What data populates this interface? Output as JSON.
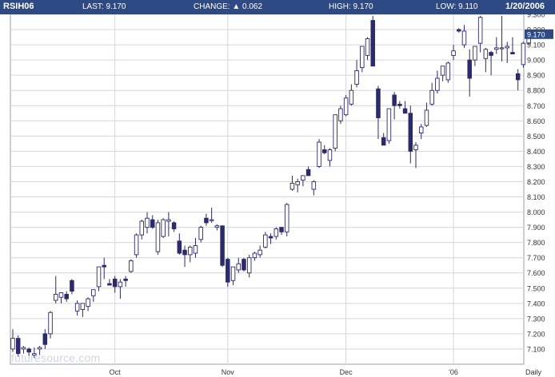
{
  "header": {
    "symbol": "RSIH06",
    "last": "LAST: 9.170",
    "change": "CHANGE: ▲ 0.062",
    "high": "HIGH: 9.170",
    "low": "LOW: 9.110",
    "date": "1/20/2006"
  },
  "watermark": "futuresource.com",
  "colors": {
    "header_bg": "#2e4a84",
    "up_candle": "#ffffff",
    "down_candle": "#2b2a6b",
    "grid": "#d3d6de",
    "last_badge": "#2e4a84"
  },
  "chart_data": {
    "type": "candlestick",
    "ylim": [
      7.0,
      9.3
    ],
    "yticks": [
      "7.100",
      "7.200",
      "7.300",
      "7.400",
      "7.500",
      "7.600",
      "7.700",
      "7.800",
      "7.900",
      "8.000",
      "8.100",
      "8.200",
      "8.300",
      "8.400",
      "8.500",
      "8.600",
      "8.700",
      "8.800",
      "8.900",
      "9.000",
      "9.100",
      "9.200",
      "9.300"
    ],
    "last_label": "9.170",
    "xlabels": [
      {
        "label": "Oct",
        "index": 19
      },
      {
        "label": "Nov",
        "index": 40
      },
      {
        "label": "Dec",
        "index": 62
      },
      {
        "label": "'06",
        "index": 82
      },
      {
        "label": "Daily",
        "index": 97
      }
    ],
    "candles": [
      [
        7.1,
        7.23,
        7.08,
        7.17
      ],
      [
        7.17,
        7.19,
        7.05,
        7.07
      ],
      [
        7.1,
        7.12,
        7.07,
        7.11
      ],
      [
        7.1,
        7.11,
        7.05,
        7.08
      ],
      [
        7.06,
        7.11,
        7.04,
        7.07
      ],
      [
        7.1,
        7.12,
        7.06,
        7.11
      ],
      [
        7.2,
        7.23,
        7.1,
        7.13
      ],
      [
        7.2,
        7.35,
        7.17,
        7.34
      ],
      [
        7.42,
        7.58,
        7.4,
        7.46
      ],
      [
        7.44,
        7.47,
        7.4,
        7.47
      ],
      [
        7.46,
        7.48,
        7.41,
        7.43
      ],
      [
        7.55,
        7.56,
        7.46,
        7.48
      ],
      [
        7.35,
        7.42,
        7.32,
        7.4
      ],
      [
        7.36,
        7.4,
        7.31,
        7.4
      ],
      [
        7.38,
        7.44,
        7.35,
        7.43
      ],
      [
        7.45,
        7.49,
        7.41,
        7.49
      ],
      [
        7.51,
        7.64,
        7.48,
        7.64
      ],
      [
        7.65,
        7.7,
        7.56,
        7.64
      ],
      [
        7.53,
        7.56,
        7.52,
        7.52
      ],
      [
        7.56,
        7.58,
        7.47,
        7.51
      ],
      [
        7.51,
        7.56,
        7.43,
        7.54
      ],
      [
        7.56,
        7.58,
        7.51,
        7.55
      ],
      [
        7.61,
        7.69,
        7.6,
        7.68
      ],
      [
        7.72,
        7.86,
        7.7,
        7.85
      ],
      [
        7.85,
        7.95,
        7.82,
        7.94
      ],
      [
        7.9,
        8.0,
        7.86,
        7.96
      ],
      [
        7.95,
        7.98,
        7.89,
        7.9
      ],
      [
        7.74,
        7.95,
        7.72,
        7.93
      ],
      [
        7.84,
        7.96,
        7.83,
        7.95
      ],
      [
        7.94,
        8.0,
        7.84,
        7.95
      ],
      [
        7.93,
        7.94,
        7.87,
        7.89
      ],
      [
        7.81,
        7.86,
        7.72,
        7.73
      ],
      [
        7.75,
        7.78,
        7.64,
        7.72
      ],
      [
        7.72,
        7.78,
        7.67,
        7.77
      ],
      [
        7.73,
        7.83,
        7.7,
        7.78
      ],
      [
        7.82,
        7.91,
        7.8,
        7.9
      ],
      [
        7.96,
        7.99,
        7.91,
        7.93
      ],
      [
        7.95,
        8.03,
        7.93,
        7.95
      ],
      [
        7.9,
        7.92,
        7.88,
        7.91
      ],
      [
        7.91,
        7.91,
        7.64,
        7.65
      ],
      [
        7.69,
        7.7,
        7.51,
        7.54
      ],
      [
        7.55,
        7.64,
        7.52,
        7.64
      ],
      [
        7.62,
        7.7,
        7.6,
        7.66
      ],
      [
        7.69,
        7.7,
        7.61,
        7.62
      ],
      [
        7.6,
        7.72,
        7.57,
        7.7
      ],
      [
        7.7,
        7.74,
        7.68,
        7.73
      ],
      [
        7.72,
        7.78,
        7.7,
        7.75
      ],
      [
        7.77,
        7.87,
        7.76,
        7.85
      ],
      [
        7.84,
        7.86,
        7.79,
        7.83
      ],
      [
        7.84,
        7.9,
        7.82,
        7.89
      ],
      [
        7.9,
        7.9,
        7.85,
        7.87
      ],
      [
        7.87,
        8.06,
        7.84,
        8.05
      ],
      [
        8.15,
        8.24,
        8.14,
        8.19
      ],
      [
        8.18,
        8.22,
        8.13,
        8.2
      ],
      [
        8.21,
        8.23,
        8.17,
        8.24
      ],
      [
        8.28,
        8.3,
        8.24,
        8.24
      ],
      [
        8.15,
        8.21,
        8.11,
        8.2
      ],
      [
        8.3,
        8.48,
        8.29,
        8.46
      ],
      [
        8.41,
        8.44,
        8.38,
        8.39
      ],
      [
        8.34,
        8.42,
        8.3,
        8.41
      ],
      [
        8.42,
        8.64,
        8.4,
        8.64
      ],
      [
        8.6,
        8.7,
        8.58,
        8.68
      ],
      [
        8.64,
        8.77,
        8.63,
        8.75
      ],
      [
        8.71,
        8.84,
        8.7,
        8.8
      ],
      [
        8.84,
        9.0,
        8.82,
        8.93
      ],
      [
        8.95,
        9.08,
        8.92,
        9.09
      ],
      [
        9.03,
        9.15,
        9.0,
        9.14
      ],
      [
        9.26,
        9.29,
        8.96,
        8.96
      ],
      [
        8.81,
        8.83,
        8.48,
        8.62
      ],
      [
        8.49,
        8.52,
        8.44,
        8.44
      ],
      [
        8.47,
        8.68,
        8.45,
        8.68
      ],
      [
        8.77,
        8.79,
        8.61,
        8.7
      ],
      [
        8.71,
        8.73,
        8.68,
        8.7
      ],
      [
        8.68,
        8.73,
        8.65,
        8.65
      ],
      [
        8.65,
        8.7,
        8.32,
        8.4
      ],
      [
        8.41,
        8.46,
        8.29,
        8.44
      ],
      [
        8.52,
        8.58,
        8.48,
        8.56
      ],
      [
        8.57,
        8.72,
        8.56,
        8.67
      ],
      [
        8.71,
        8.85,
        8.7,
        8.8
      ],
      [
        8.8,
        8.93,
        8.78,
        8.88
      ],
      [
        8.9,
        8.96,
        8.86,
        8.96
      ],
      [
        8.87,
        8.99,
        8.85,
        8.98
      ],
      [
        9.03,
        9.1,
        9.0,
        9.06
      ],
      [
        9.2,
        9.21,
        9.18,
        9.19
      ],
      [
        9.1,
        9.23,
        9.08,
        9.19
      ],
      [
        9.0,
        9.07,
        8.76,
        8.88
      ],
      [
        9.0,
        9.06,
        8.96,
        9.09
      ],
      [
        9.11,
        9.29,
        9.05,
        9.28
      ],
      [
        9.01,
        9.08,
        8.92,
        9.07
      ],
      [
        9.05,
        9.06,
        8.9,
        9.03
      ],
      [
        9.07,
        9.15,
        9.04,
        9.08
      ],
      [
        9.08,
        9.29,
        8.99,
        9.08
      ],
      [
        9.08,
        9.12,
        8.98,
        9.09
      ],
      [
        9.05,
        9.15,
        9.04,
        9.04
      ],
      [
        8.91,
        8.94,
        8.8,
        8.87
      ],
      [
        8.97,
        9.12,
        8.95,
        9.11
      ],
      [
        9.11,
        9.17,
        9.1,
        9.17
      ]
    ]
  }
}
